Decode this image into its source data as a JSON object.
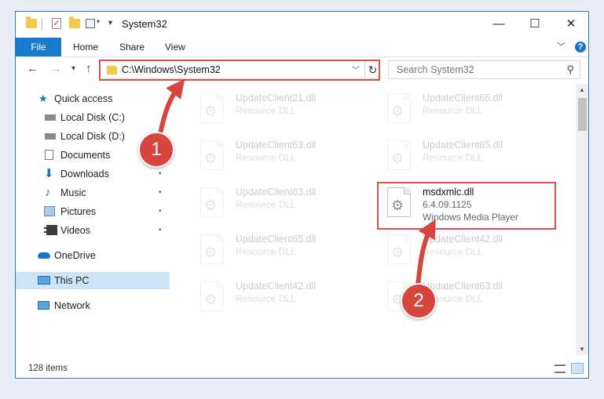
{
  "window": {
    "title": "System32"
  },
  "title_bar": {
    "minimize": "—",
    "maximize": "☐",
    "close": "✕",
    "check": "✓",
    "caret": "▾",
    "down": "▾"
  },
  "ribbon": {
    "file": "File",
    "home": "Home",
    "share": "Share",
    "view": "View",
    "expand": "﹀",
    "help": "?"
  },
  "nav": {
    "back": "←",
    "forward": "→",
    "recent": "▾",
    "up": "↑"
  },
  "address": {
    "path": "C:\\Windows\\System32",
    "caret": "﹀",
    "refresh": "↻"
  },
  "search": {
    "placeholder": "Search System32",
    "icon": "⚲"
  },
  "sidebar": {
    "quick_access": "Quick access",
    "local_c": "Local Disk (C:)",
    "local_d": "Local Disk (D:)",
    "documents": "Documents",
    "downloads": "Downloads",
    "music": "Music",
    "pictures": "Pictures",
    "videos": "Videos",
    "onedrive": "OneDrive",
    "this_pc": "This PC",
    "network": "Network",
    "pin": "📌"
  },
  "files": {
    "f1": {
      "name": "UpdateClient21.dll",
      "type": "Resource DLL"
    },
    "f2": {
      "name": "UpdateClient65.dll",
      "type": "Resource DLL"
    },
    "f3": {
      "name": "UpdateClient63.dll",
      "type": "Resource DLL"
    },
    "f4": {
      "name": "UpdateClient65.dll",
      "type": "Resource DLL"
    },
    "f5": {
      "name": "UpdateClient63.dll",
      "type": "Resource DLL"
    },
    "f6": {
      "name": "msdxmlc.dll",
      "version": "6.4.09.1125",
      "description": "Windows Media Player"
    },
    "f7": {
      "name": "UpdateClient65.dll",
      "type": "Resource DLL"
    },
    "f8": {
      "name": "UpdateClient42.dll",
      "type": "Resource DLL"
    },
    "f9": {
      "name": "UpdateClient42.dll",
      "type": "Resource DLL"
    },
    "f10": {
      "name": "UpdateClient63.dll",
      "type": "Resource DLL"
    }
  },
  "gear": "⚙",
  "status": {
    "items": "128 items"
  },
  "scroll": {
    "up": "▲",
    "down": "▼"
  },
  "badges": {
    "one": "1",
    "two": "2"
  },
  "colors": {
    "accent": "#1979ca",
    "highlight": "#d9534f",
    "selection": "#cce4f7"
  }
}
